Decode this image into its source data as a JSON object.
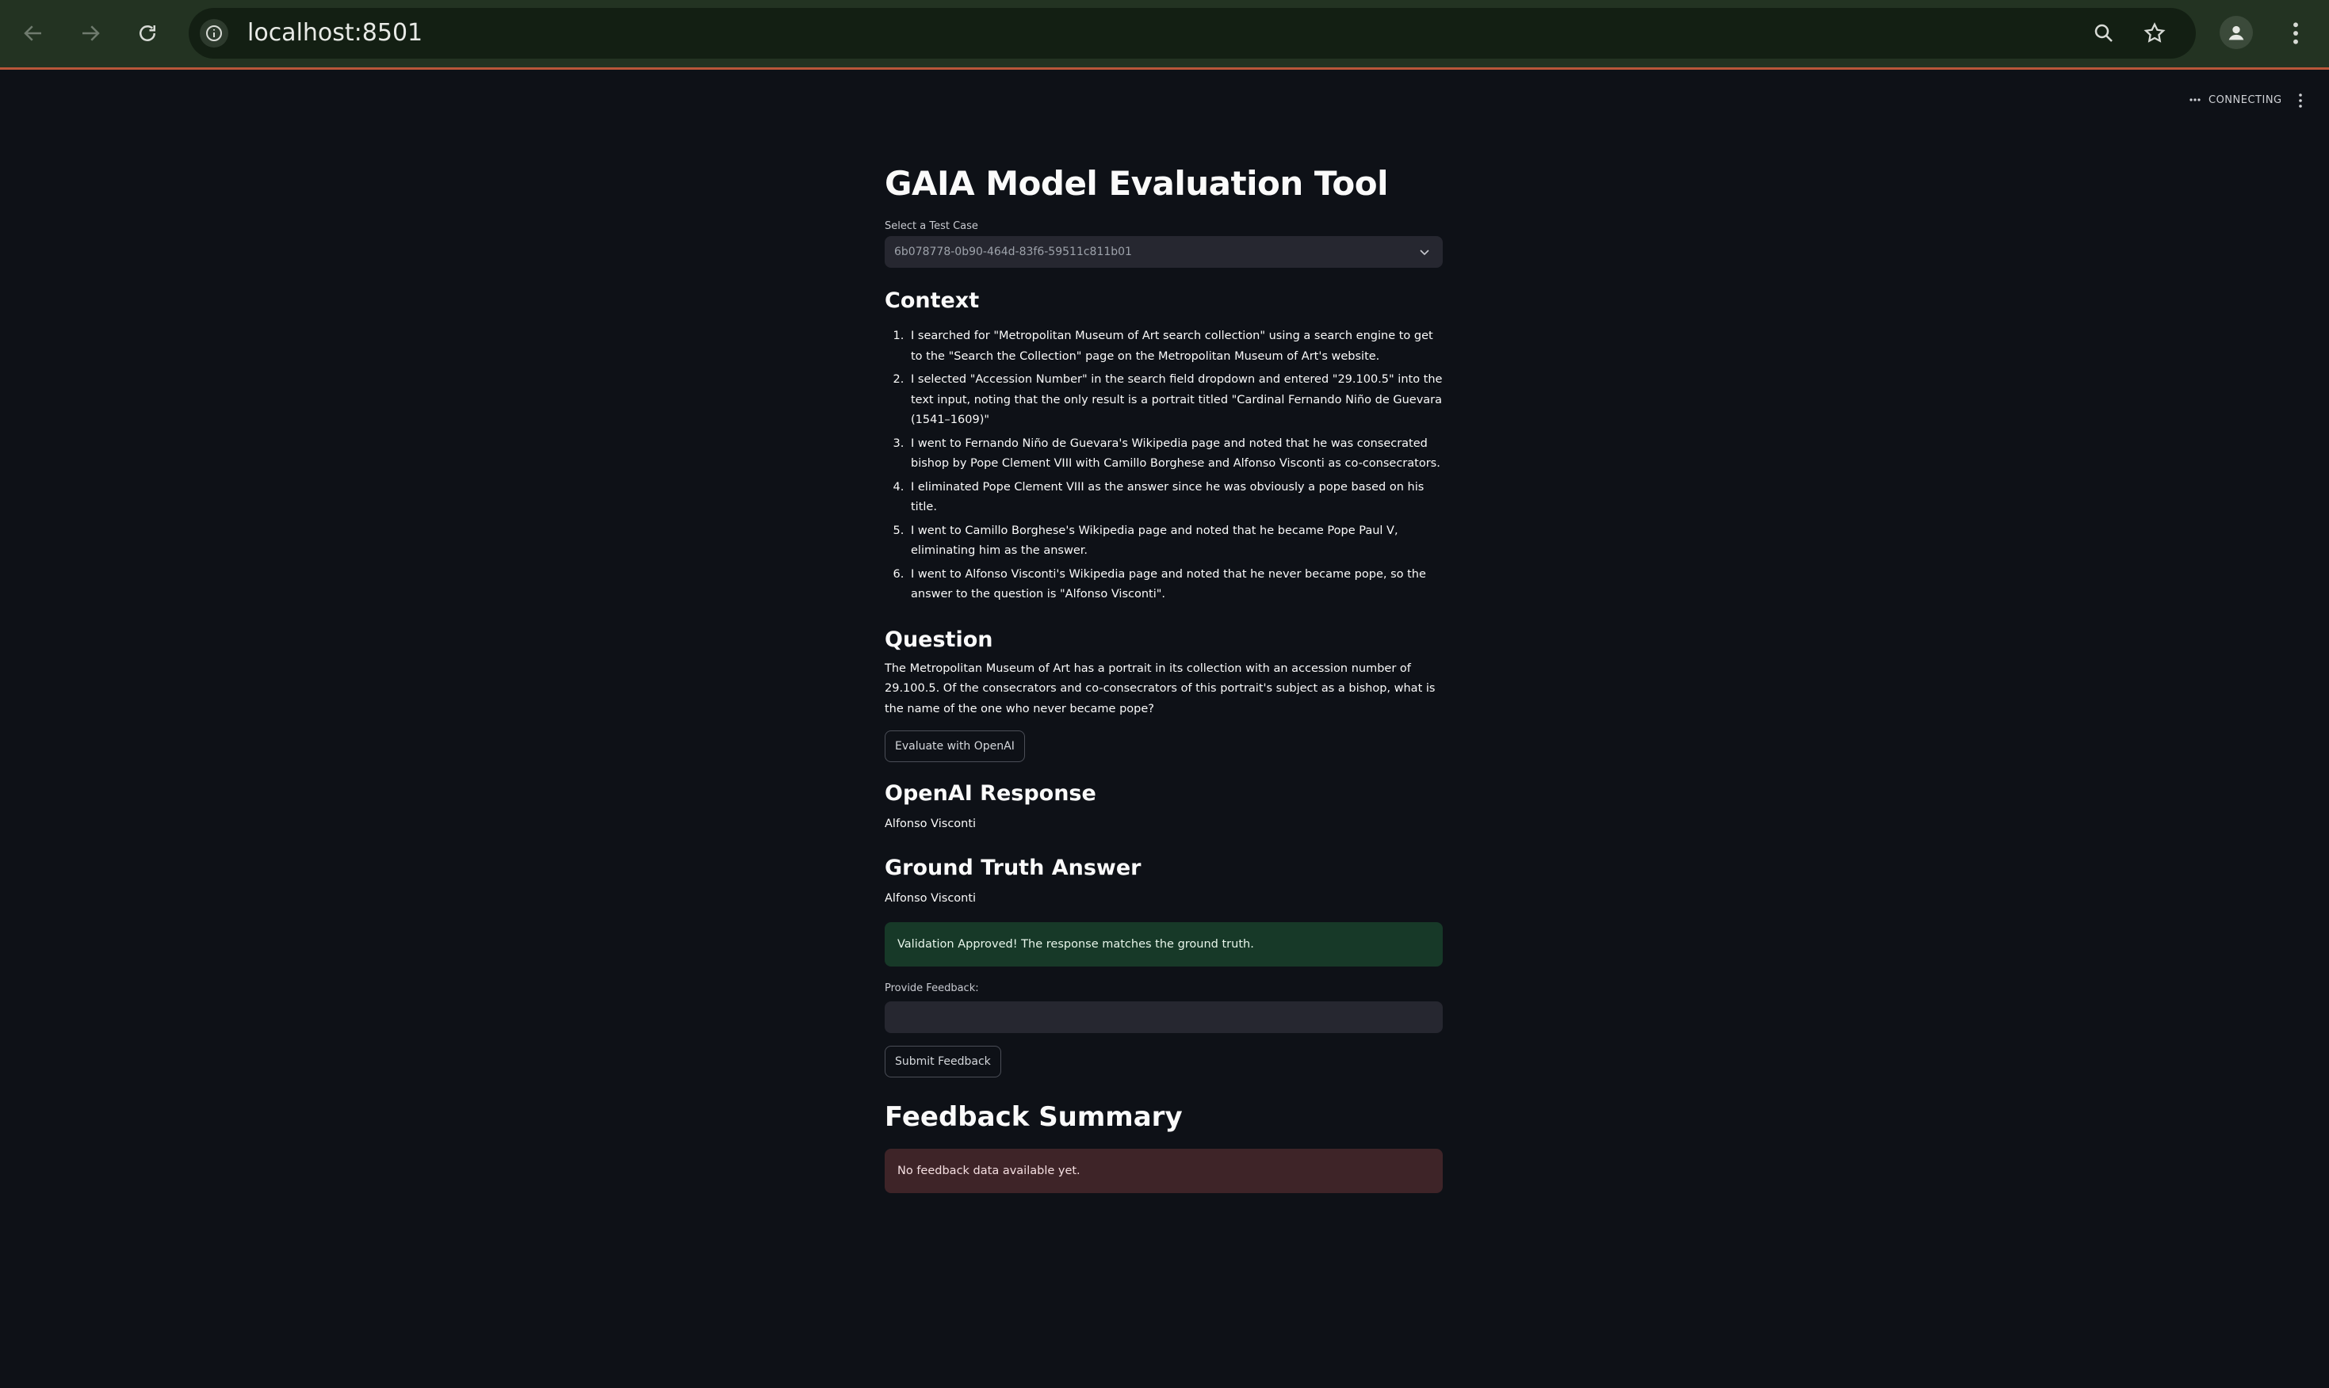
{
  "browser": {
    "url": "localhost:8501"
  },
  "status": {
    "text": "CONNECTING"
  },
  "app": {
    "title": "GAIA Model Evaluation Tool",
    "select_label": "Select a Test Case",
    "select_value": "6b078778-0b90-464d-83f6-59511c811b01",
    "context_heading": "Context",
    "context_steps": [
      "I searched for \"Metropolitan Museum of Art search collection\" using a search engine to get to the \"Search the Collection\" page on the Metropolitan Museum of Art's website.",
      "I selected \"Accession Number\" in the search field dropdown and entered \"29.100.5\" into the text input, noting that the only result is a portrait titled \"Cardinal Fernando Niño de Guevara (1541–1609)\"",
      "I went to Fernando Niño de Guevara's Wikipedia page and noted that he was consecrated bishop by Pope Clement VIII with Camillo Borghese and Alfonso Visconti as co-consecrators.",
      "I eliminated Pope Clement VIII as the answer since he was obviously a pope based on his title.",
      "I went to Camillo Borghese's Wikipedia page and noted that he became Pope Paul V, eliminating him as the answer.",
      "I went to Alfonso Visconti's Wikipedia page and noted that he never became pope, so the answer to the question is \"Alfonso Visconti\"."
    ],
    "question_heading": "Question",
    "question_text": "The Metropolitan Museum of Art has a portrait in its collection with an accession number of 29.100.5. Of the consecrators and co-consecrators of this portrait's subject as a bishop, what is the name of the one who never became pope?",
    "evaluate_button": "Evaluate with OpenAI",
    "response_heading": "OpenAI Response",
    "response_text": "Alfonso Visconti",
    "ground_truth_heading": "Ground Truth Answer",
    "ground_truth_text": "Alfonso Visconti",
    "success_message": "Validation Approved! The response matches the ground truth.",
    "feedback_label": "Provide Feedback:",
    "feedback_value": "",
    "submit_button": "Submit Feedback",
    "summary_heading": "Feedback Summary",
    "summary_message": "No feedback data available yet."
  },
  "colors": {
    "background": "#0e1117",
    "chrome": "#233322",
    "success_bg": "#173928",
    "error_bg": "#3e2428"
  }
}
